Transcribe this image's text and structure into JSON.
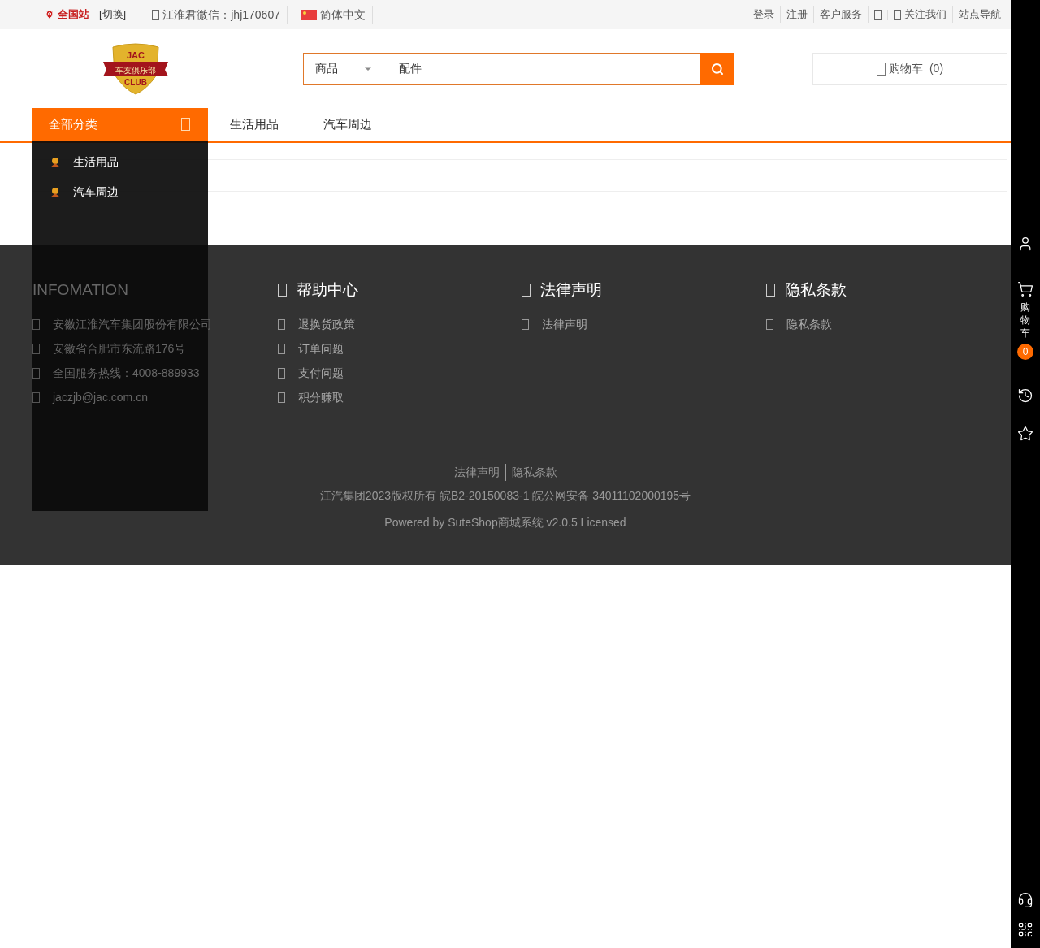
{
  "top_bar": {
    "location": "全国站",
    "switch": "[切换]",
    "wechat": "江淮君微信：jhj170607",
    "language": "简体中文",
    "links": [
      "登录",
      "注册",
      "客户服务"
    ],
    "follow": "关注我们",
    "site_nav": "站点导航"
  },
  "logo": {
    "top": "JAC",
    "ribbon": "车友俱乐部",
    "bottom": "CLUB"
  },
  "search": {
    "scope": "商品",
    "value": "配件"
  },
  "cart": {
    "label": "购物车",
    "count": "(0)"
  },
  "nav": {
    "all_categories": "全部分类",
    "items": [
      "生活用品",
      "汽车周边"
    ]
  },
  "category_menu": [
    "生活用品",
    "汽车周边"
  ],
  "footer": {
    "info": {
      "title": "INFOMATION",
      "lines": [
        "安徽江淮汽车集团股份有限公司",
        "安徽省合肥市东流路176号",
        "全国服务热线：4008-889933",
        "jaczjb@jac.com.cn"
      ]
    },
    "columns": [
      {
        "title": "帮助中心",
        "links": [
          "退换货政策",
          "订单问题",
          "支付问题",
          "积分赚取"
        ]
      },
      {
        "title": "法律声明",
        "links": [
          "法律声明"
        ]
      },
      {
        "title": "隐私条款",
        "links": [
          "隐私条款"
        ]
      }
    ],
    "bottom_links": [
      "法律声明",
      "隐私条款"
    ],
    "copyright": "江汽集团2023版权所有 皖B2-20150083-1 皖公网安备 34011102000195号",
    "powered": "Powered by SuteShop商城系统 v2.0.5 Licensed"
  },
  "side_bar": {
    "cart_label": "购物车",
    "cart_count": "0"
  }
}
